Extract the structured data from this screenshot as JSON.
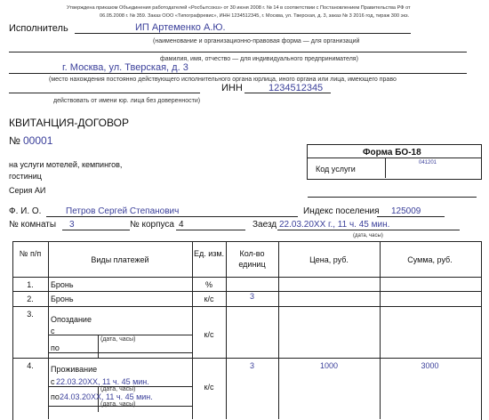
{
  "header_note": [
    "Утверждена приказом Объединения работодателей «Росбытсоюз» от 30 июня 2008 г. № 14 в соответствии с Постановлением Правительства РФ от",
    "06.05.2008 г. № 359. Заказ ООО «Типографревис», ИНН 1234512345, г. Москва, ул. Тверская, д. 3, заказ № 3 2016 год, тираж 300 экз."
  ],
  "executor": {
    "label": "Исполнитель",
    "value": "ИП Артеменко А.Ю.",
    "caption1": "(наименование и организационно-правовая форма — для организаций",
    "caption2": "фамилия, имя, отчество — для индивидуального предпринимателя)",
    "address": "г. Москва, ул. Тверская, д. 3",
    "address_caption": "(место нахождения постоянно действующего исполнительного органа юрлица, иного органа или лица, имеющего право",
    "inn_label": "ИНН",
    "inn_value": "1234512345",
    "proxy_caption": "действовать от имени юр. лица без доверенности)"
  },
  "doc": {
    "title": "КВИТАНЦИЯ-ДОГОВОР",
    "number_label": "№",
    "number_value": "00001",
    "service_line1": "на услуги мотелей, кемпингов,",
    "service_line2": "гостиниц",
    "series_label": "Серия АИ"
  },
  "form": {
    "title": "Форма БО-18",
    "code_label": "Код услуги",
    "code_value": "041201"
  },
  "guest": {
    "fio_label": "Ф. И. О.",
    "fio_value": "Петров Сергей Степанович",
    "index_label": "Индекс поселения",
    "index_value": "125009",
    "room_label": "№ комнаты",
    "room_value": "3",
    "building_label": "№ корпуса",
    "building_value": "4",
    "checkin_label": "Заезд",
    "checkin_value": "22.03.20XX г., 11 ч. 45 мин.",
    "datetime_caption": "(дата, часы)"
  },
  "table": {
    "headers": [
      "№ п/п",
      "Виды платежей",
      "Ед. изм.",
      "Кол-во единиц",
      "Цена, руб.",
      "Сумма, руб."
    ],
    "rows": [
      {
        "n": "1.",
        "name": "Бронь",
        "unit": "%",
        "qty": "",
        "price": "",
        "sum": ""
      },
      {
        "n": "2.",
        "name": "Бронь",
        "unit": "к/с",
        "qty": "3",
        "price": "",
        "sum": ""
      },
      {
        "n": "3.",
        "name": "Опоздание",
        "unit": "к/с",
        "qty": "",
        "price": "",
        "sum": "",
        "from_label": "с",
        "from_value": "",
        "to_label": "по",
        "to_value": "",
        "caption": "(дата, часы)"
      },
      {
        "n": "4.",
        "name": "Проживание",
        "unit": "к/с",
        "qty": "3",
        "price": "1000",
        "sum": "3000",
        "from_label": "с",
        "from_value": "22.03.20XX, 11 ч. 45 мин.",
        "to_label": "по",
        "to_value": "24.03.20XX, 11 ч. 45 мин.",
        "caption": "(дата, часы)"
      }
    ]
  }
}
